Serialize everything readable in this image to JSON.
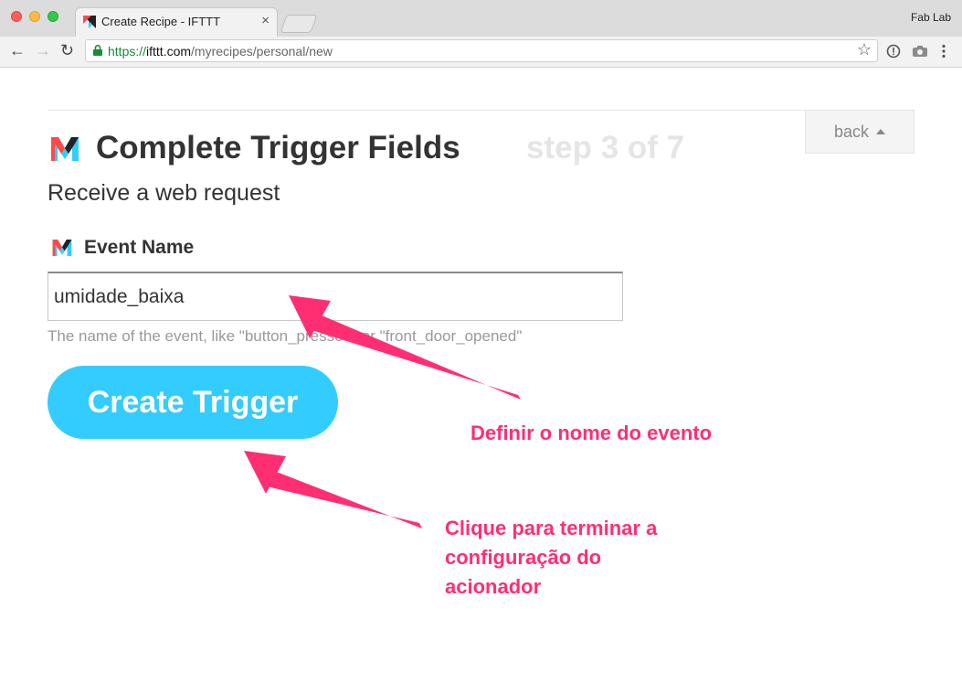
{
  "browser": {
    "tab_title": "Create Recipe - IFTTT",
    "profile_name": "Fab Lab",
    "url": {
      "scheme": "https://",
      "host": "ifttt.com",
      "path": "/myrecipes/personal/new"
    }
  },
  "page": {
    "back_label": "back",
    "title": "Complete Trigger Fields",
    "step": "step 3 of 7",
    "subtitle": "Receive a web request",
    "field_label": "Event Name",
    "field_value": "umidade_baixa",
    "field_helper": "The name of the event, like \"button_pressed\" or \"front_door_opened\"",
    "create_button": "Create Trigger"
  },
  "annotations": {
    "event_name_note": "Definir o nome do evento",
    "finish_note_lines": [
      "Clique para terminar a",
      "configuração do",
      "acionador"
    ]
  },
  "colors": {
    "accent": "#33ccff",
    "annotation": "#ff2e72",
    "secure": "#1a8a3b"
  },
  "icons": [
    "maker-logo-icon",
    "lock-icon",
    "star-icon",
    "camera-icon",
    "menu-dots-icon",
    "back-arrow-icon",
    "forward-arrow-icon",
    "reload-icon",
    "close-icon",
    "triangle-up-icon"
  ]
}
